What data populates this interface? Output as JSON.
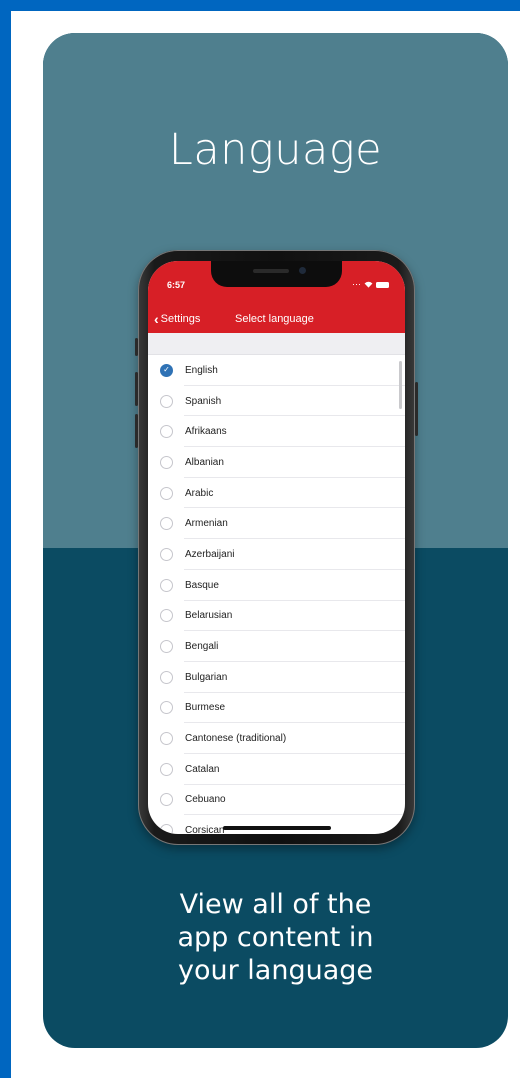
{
  "promo": {
    "headline": "Language",
    "caption_lines": [
      "View all of the",
      "app content in",
      "your language"
    ]
  },
  "status_bar": {
    "time": "6:57"
  },
  "nav": {
    "back_label": "Settings",
    "title": "Select language"
  },
  "languages": [
    {
      "label": "English",
      "selected": true
    },
    {
      "label": "Spanish",
      "selected": false
    },
    {
      "label": "Afrikaans",
      "selected": false
    },
    {
      "label": "Albanian",
      "selected": false
    },
    {
      "label": "Arabic",
      "selected": false
    },
    {
      "label": "Armenian",
      "selected": false
    },
    {
      "label": "Azerbaijani",
      "selected": false
    },
    {
      "label": "Basque",
      "selected": false
    },
    {
      "label": "Belarusian",
      "selected": false
    },
    {
      "label": "Bengali",
      "selected": false
    },
    {
      "label": "Bulgarian",
      "selected": false
    },
    {
      "label": "Burmese",
      "selected": false
    },
    {
      "label": "Cantonese (traditional)",
      "selected": false
    },
    {
      "label": "Catalan",
      "selected": false
    },
    {
      "label": "Cebuano",
      "selected": false
    },
    {
      "label": "Corsican",
      "selected": false
    }
  ],
  "colors": {
    "outer_border": "#0066c0",
    "card_top": "#4f7f8e",
    "card_bottom": "#0b4b62",
    "app_bar": "#d71f26",
    "selected_radio": "#2f72b5"
  },
  "icons": {
    "back": "chevron-left-icon",
    "check": "checkmark-icon",
    "signal": "signal-icon",
    "wifi": "wifi-icon",
    "battery": "battery-icon"
  }
}
